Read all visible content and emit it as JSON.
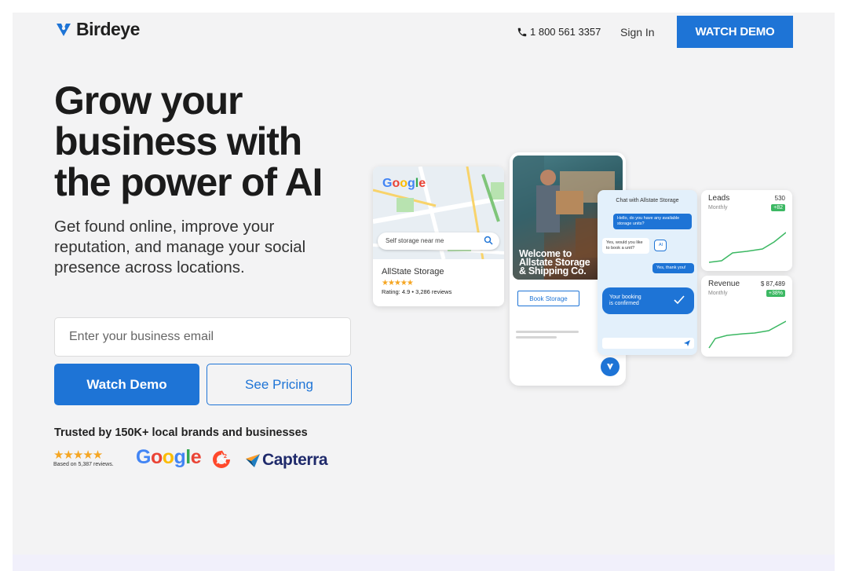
{
  "header": {
    "logo_text": "Birdeye",
    "phone": "1 800 561 3357",
    "signin_label": "Sign In",
    "cta_label": "WATCH DEMO"
  },
  "hero": {
    "title": "Grow your business with the power of AI",
    "subtitle": "Get found online, improve your reputation, and manage your social presence across locations.",
    "email_placeholder": "Enter your business email",
    "email_value": "",
    "primary_button": "Watch Demo",
    "secondary_button": "See Pricing"
  },
  "trust": {
    "heading": "Trusted by 150K+ local brands and businesses",
    "stars": "★★★★★",
    "rating_value": 4.5,
    "reviews_note": "Based on 5,387 reviews.",
    "logos": [
      "Google",
      "G2",
      "Capterra"
    ],
    "capterra_label": "Capterra",
    "google_label": "Google",
    "g2_label": "G2"
  },
  "illustration": {
    "map_brand": "Google",
    "map_search": "Self storage near me",
    "business_name": "AllState Storage",
    "business_stars": "★★★★★",
    "business_meta": "Rating: 4.9 • 3,286 reviews",
    "phone_welcome_lines": [
      "Welcome to",
      "Allstate Storage",
      "& Shipping Co."
    ],
    "book_button": "Book Storage",
    "chat_header": "Chat with Allstate Storage",
    "chat_messages": [
      {
        "from": "customer",
        "text": "Hello, do you have any available storage units?"
      },
      {
        "from": "business",
        "text": "Yes, would you like to book a unit?"
      },
      {
        "from": "customer",
        "text": "Yes, thank you!"
      }
    ],
    "ai_badge": "AI",
    "confirm_lines": [
      "Your booking",
      "is confirmed"
    ],
    "leads": {
      "title": "Leads",
      "value": "530",
      "sub": "Monthly",
      "badge": "+82"
    },
    "revenue": {
      "title": "Revenue",
      "value": "$ 87,489",
      "sub": "Monthly",
      "badge": "+38%"
    }
  },
  "colors": {
    "brand_blue": "#1e74d6",
    "background": "#f3f3f4",
    "star": "#f5a623",
    "positive": "#3cb863"
  },
  "icons": [
    "birdeye-logo-icon",
    "phone-icon",
    "search-icon",
    "check-icon",
    "send-icon",
    "g2-logo-icon",
    "capterra-logo-icon"
  ]
}
